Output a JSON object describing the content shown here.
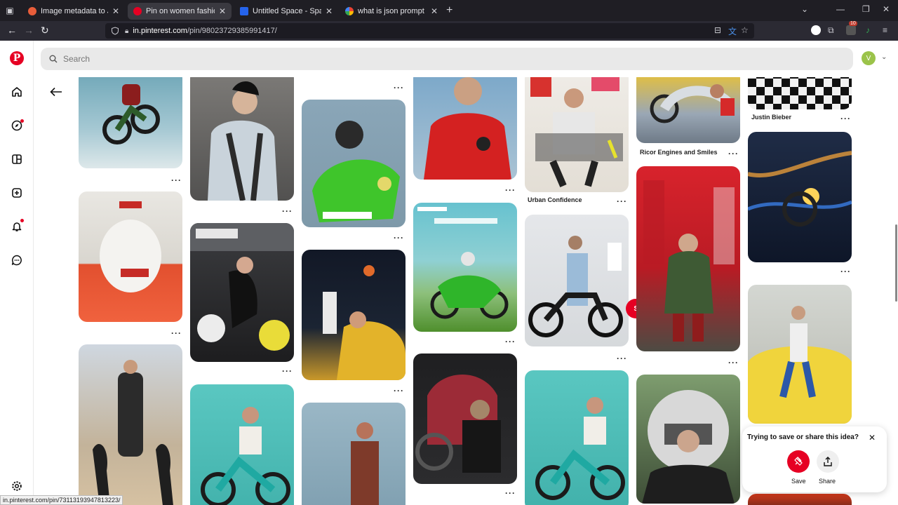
{
  "browser": {
    "tabs": [
      {
        "title": "Image metadata to JSON conve",
        "favicon_color": "#e85d3a",
        "active": false
      },
      {
        "title": "Pin on women fashion",
        "favicon_color": "#e60023",
        "active": true
      },
      {
        "title": "Untitled Space - Spaces | Freep",
        "favicon_color": "#2563eb",
        "active": false
      },
      {
        "title": "what is json prompt - Google S",
        "favicon_color": "#34a853",
        "active": false
      }
    ],
    "url_host": "in.pinterest.com",
    "url_path": "/pin/98023729385991417/",
    "status_url": "in.pinterest.com/pin/73113193947813223/",
    "extension_badge": "10"
  },
  "pinterest": {
    "search_placeholder": "Search",
    "avatar_letter": "V",
    "accent_color": "#e60023",
    "rail_icons": [
      "pinterest-logo",
      "home-icon",
      "explore-icon",
      "boards-icon",
      "create-icon",
      "notifications-icon",
      "messages-icon",
      "settings-icon"
    ],
    "pin_titles": {
      "justin": "Justin Bieber",
      "ricor": "Ricor Engines and Smiles",
      "urban": "Urban Confidence"
    },
    "save_label": "Save",
    "popup": {
      "title": "Trying to save or share this idea?",
      "save_label": "Save",
      "share_label": "Share"
    }
  }
}
